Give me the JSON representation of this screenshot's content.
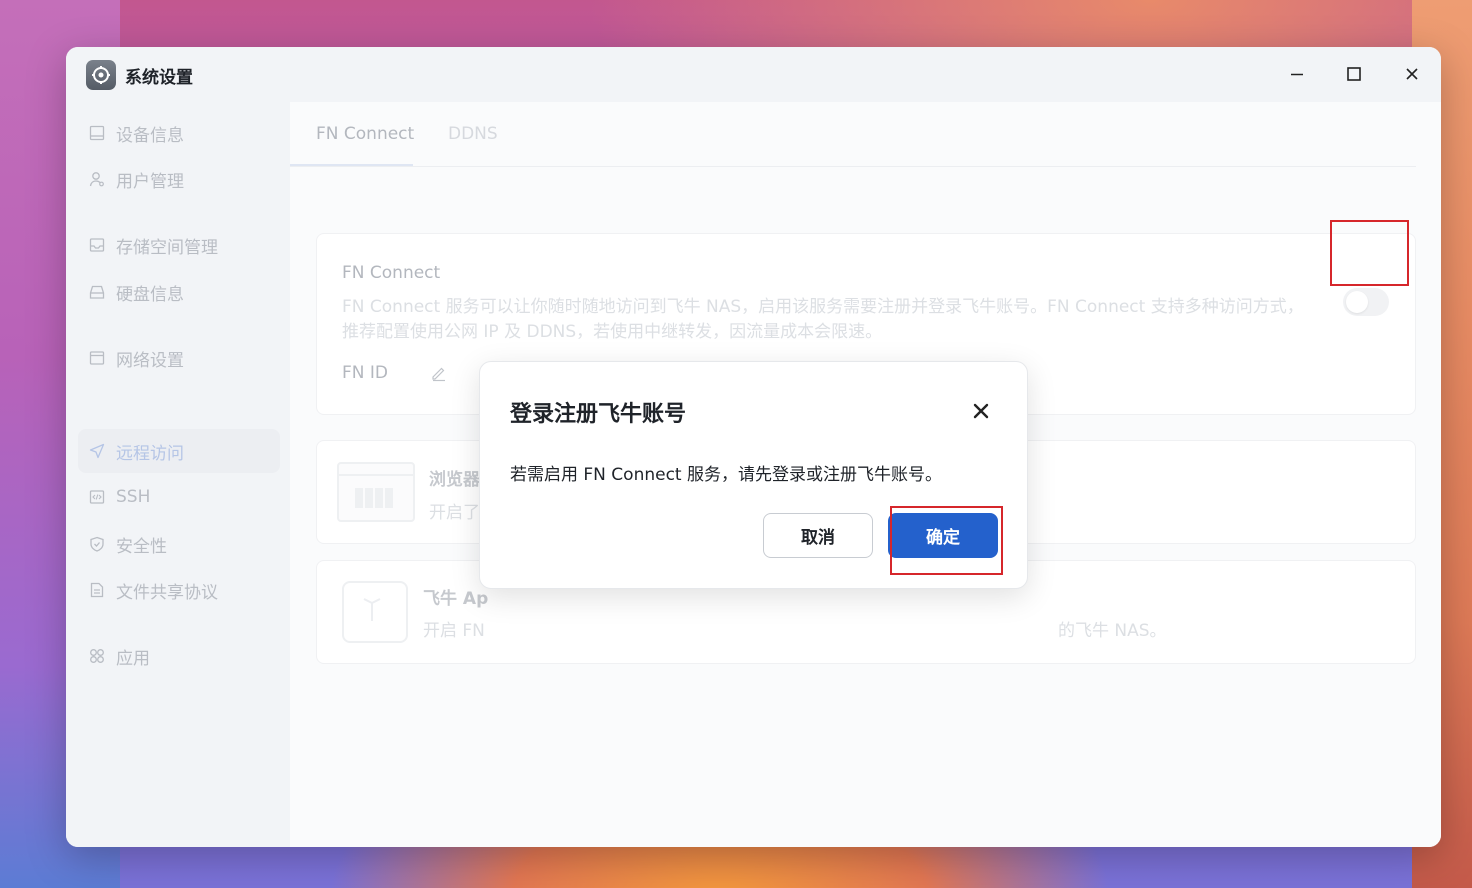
{
  "window": {
    "title": "系统设置"
  },
  "sidebar": {
    "items": [
      {
        "label": "设备信息",
        "icon": "device-icon"
      },
      {
        "label": "用户管理",
        "icon": "user-icon"
      },
      {
        "label": "存储空间管理",
        "icon": "storage-icon"
      },
      {
        "label": "硬盘信息",
        "icon": "disk-icon"
      },
      {
        "label": "网络设置",
        "icon": "network-icon"
      },
      {
        "label": "远程访问",
        "icon": "send-icon",
        "active": true
      },
      {
        "label": "SSH",
        "icon": "code-icon"
      },
      {
        "label": "安全性",
        "icon": "shield-icon"
      },
      {
        "label": "文件共享协议",
        "icon": "file-icon"
      },
      {
        "label": "应用",
        "icon": "apps-icon"
      }
    ]
  },
  "tabs": [
    {
      "label": "FN Connect",
      "active": true
    },
    {
      "label": "DDNS",
      "active": false
    }
  ],
  "fn_connect_card": {
    "title": "FN Connect",
    "description_line1": "FN Connect 服务可以让你随时随地访问到飞牛 NAS，启用该服务需要注册并登录飞牛账号。FN Connect 支持多种访问方式，",
    "description_line2": "推荐配置使用公网 IP 及 DDNS，若使用中继转发，因流量成本会限速。",
    "fn_id_label": "FN ID",
    "toggle_on": false
  },
  "browser_card": {
    "title_partial": "浏览器",
    "desc_partial": "开启了"
  },
  "app_card": {
    "title_partial": "飞牛 Ap",
    "desc_left": "开启 FN",
    "desc_right": "的飞牛 NAS。"
  },
  "dialog": {
    "title": "登录注册飞牛账号",
    "message": "若需启用 FN Connect 服务，请先登录或注册飞牛账号。",
    "cancel_label": "取消",
    "ok_label": "确定"
  },
  "colors": {
    "accent": "#2461cc",
    "highlight_box": "#d6262b"
  }
}
